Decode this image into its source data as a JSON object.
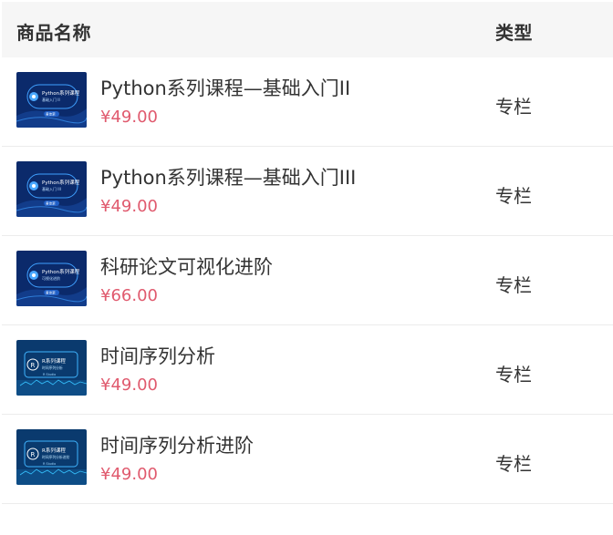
{
  "header": {
    "name_label": "商品名称",
    "type_label": "类型"
  },
  "items": [
    {
      "title": "Python系列课程—基础入门II",
      "price": "¥49.00",
      "type": "专栏",
      "thumb": {
        "kind": "python",
        "line1": "Python系列课程",
        "line2": "基础入门 II",
        "badge": "黄佳荣"
      }
    },
    {
      "title": "Python系列课程—基础入门III",
      "price": "¥49.00",
      "type": "专栏",
      "thumb": {
        "kind": "python",
        "line1": "Python系列课程",
        "line2": "基础入门 III",
        "badge": "黄佳荣"
      }
    },
    {
      "title": "科研论文可视化进阶",
      "price": "¥66.00",
      "type": "专栏",
      "thumb": {
        "kind": "python",
        "line1": "Python系列课程",
        "line2": "可视化进阶",
        "badge": "黄佳荣"
      }
    },
    {
      "title": "时间序列分析",
      "price": "¥49.00",
      "type": "专栏",
      "thumb": {
        "kind": "r",
        "line1": "R系列课程",
        "line2": "时间序列分析",
        "badge": "R Studio"
      }
    },
    {
      "title": "时间序列分析进阶",
      "price": "¥49.00",
      "type": "专栏",
      "thumb": {
        "kind": "r",
        "line1": "R系列课程",
        "line2": "时间序列分析进阶",
        "badge": "R Studio"
      }
    }
  ],
  "colors": {
    "price": "#e05a6e",
    "thumb_bg": "#0b2a6b",
    "header_bg": "#f6f6f6"
  }
}
